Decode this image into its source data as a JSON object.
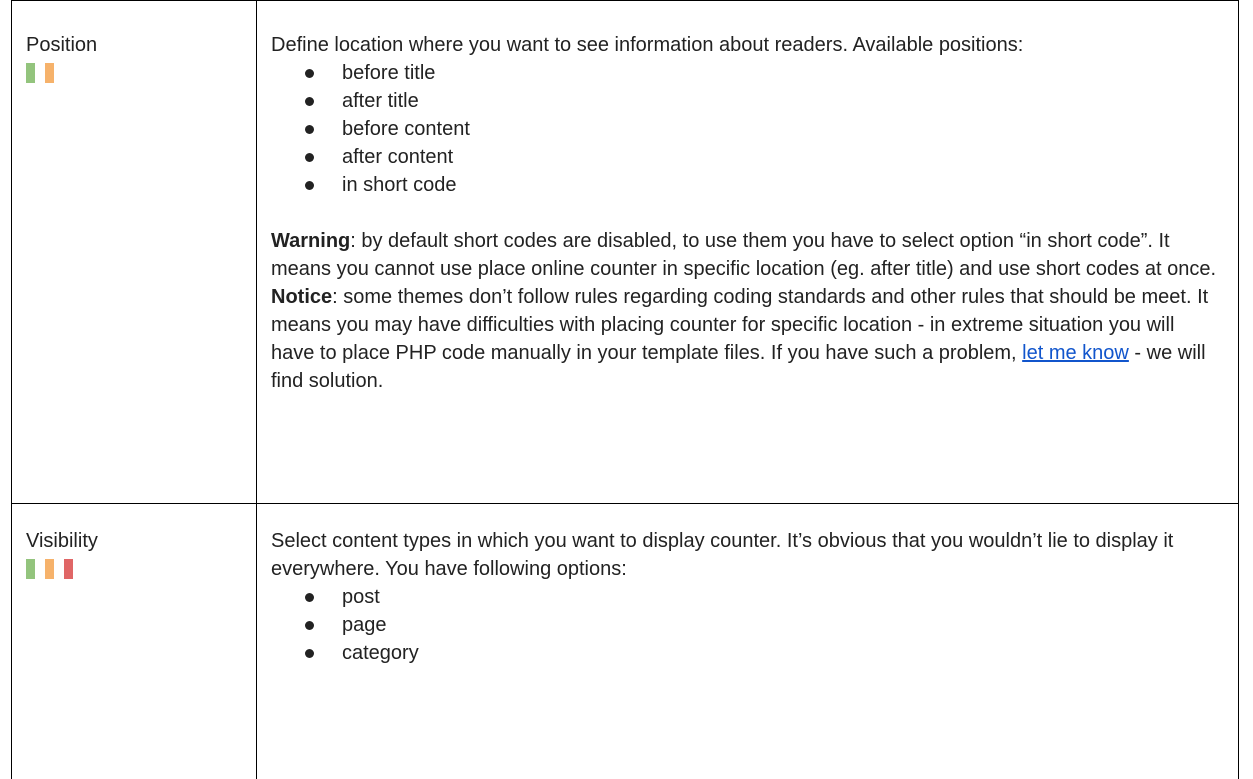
{
  "colors": {
    "green": "#93c47d",
    "orange": "#f6b26b",
    "red": "#e06666",
    "link": "#1155cc"
  },
  "rows": [
    {
      "label": "Position",
      "indicators": [
        "green",
        "orange"
      ],
      "intro": "Define location where you want to see information about readers. Available positions:",
      "options": [
        "before title",
        "after title",
        "before content",
        "after content",
        "in short code"
      ],
      "warning_label": "Warning",
      "warning_text": ": by default short codes are disabled, to use them you have to select option “in short code”. It means you cannot use place online counter in specific location (eg. after title) and use short codes at once.",
      "notice_label": "Notice",
      "notice_text_before": ": some themes don’t follow rules regarding coding standards and other rules that should be meet. It means you may have difficulties with placing counter for specific location - in extreme situation you will have to place PHP code manually in your template files. If you have such a problem, ",
      "notice_link": "let me know",
      "notice_text_after": " - we will find solution."
    },
    {
      "label": "Visibility",
      "indicators": [
        "green",
        "orange",
        "red"
      ],
      "intro": "Select content types in which you want to display counter. It’s obvious that you wouldn’t lie to display it everywhere. You have following options:",
      "options": [
        "post",
        "page",
        "category"
      ]
    }
  ]
}
